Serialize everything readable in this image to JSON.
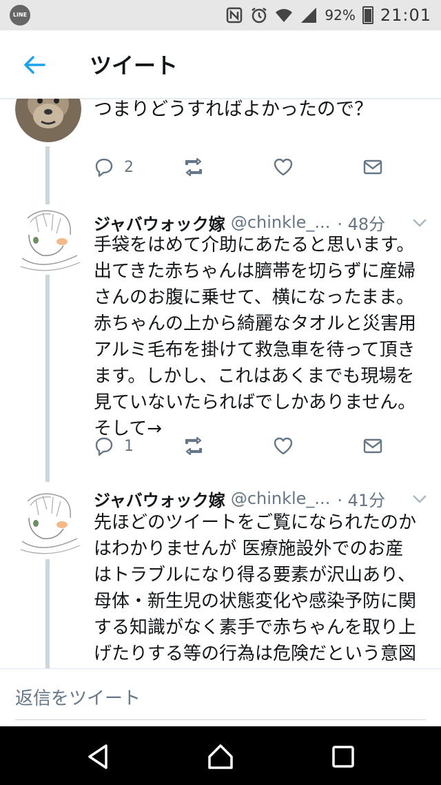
{
  "status_bar": {
    "battery": "92%",
    "time": "21:01"
  },
  "header": {
    "title": "ツイート"
  },
  "tweets": [
    {
      "text": "つまりどうすればよかったので？",
      "reply_count": "2",
      "retweet_count": "",
      "like_count": ""
    },
    {
      "display_name": "ジャバウォック嫁",
      "handle": "@chinkle_...",
      "time": "· 48分",
      "text": "手袋をはめて介助にあたると思います。\n出てきた赤ちゃんは臍帯を切らずに産婦\nさんのお腹に乗せて、横になったまま。\n赤ちゃんの上から綺麗なタオルと災害用\nアルミ毛布を掛けて救急車を待って頂き\nます。しかし、これはあくまでも現場を\n見ていないたらればでしかありません。\nそして→",
      "reply_count": "1"
    },
    {
      "display_name": "ジャバウォック嫁",
      "handle": "@chinkle_...",
      "time": "· 41分",
      "text": "先ほどのツイートをご覧になられたのか\nはわかりませんが 医療施設外でのお産\nはトラブルになり得る要素が沢山あり、\n母体・新生児の状態変化や感染予防に関\nする知識がなく素手で赤ちゃんを取り上\nげたりする等の行為は危険だという意図\nを汲んで頂けず、とても残念に思いま"
    }
  ],
  "composer": {
    "placeholder": "返信をツイート"
  },
  "colors": {
    "accent": "#1da1f2",
    "thread_line": "#ccd6dd",
    "secondary_text": "#657786"
  }
}
